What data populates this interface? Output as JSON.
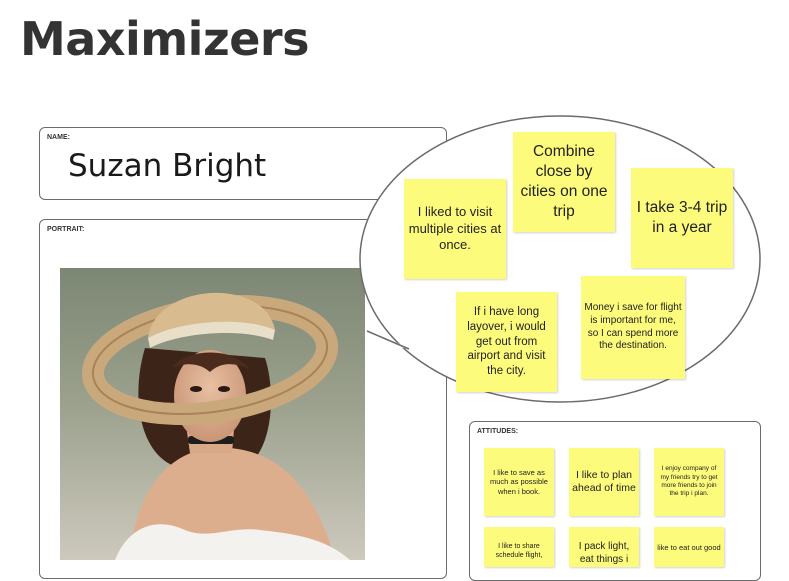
{
  "page": {
    "title": "Maximizers"
  },
  "name_card": {
    "label": "NAME:",
    "value": "Suzan Bright"
  },
  "portrait_card": {
    "label": "PORTRAIT:"
  },
  "quotes": [
    "I liked to visit multiple cities at once.",
    "Combine close by cities on one trip",
    "I take 3-4 trip in a year",
    "If i have long layover, i would get out from airport and visit the city.",
    "Money i save for flight is important for me,  so I can spend more the destination."
  ],
  "attitudes": {
    "label": "ATTITUDES:",
    "notes": [
      "I like to save as much as possible when i book.",
      "I like to plan ahead of time",
      "I enjoy company of my friends try to get more friends to join the trip i plan.",
      "I like to share schedule flight,",
      "I pack light, eat things i",
      "like to eat out good"
    ]
  },
  "colors": {
    "sticky": "#fdfb7c",
    "border": "#6b6b6b",
    "title": "#333333"
  }
}
